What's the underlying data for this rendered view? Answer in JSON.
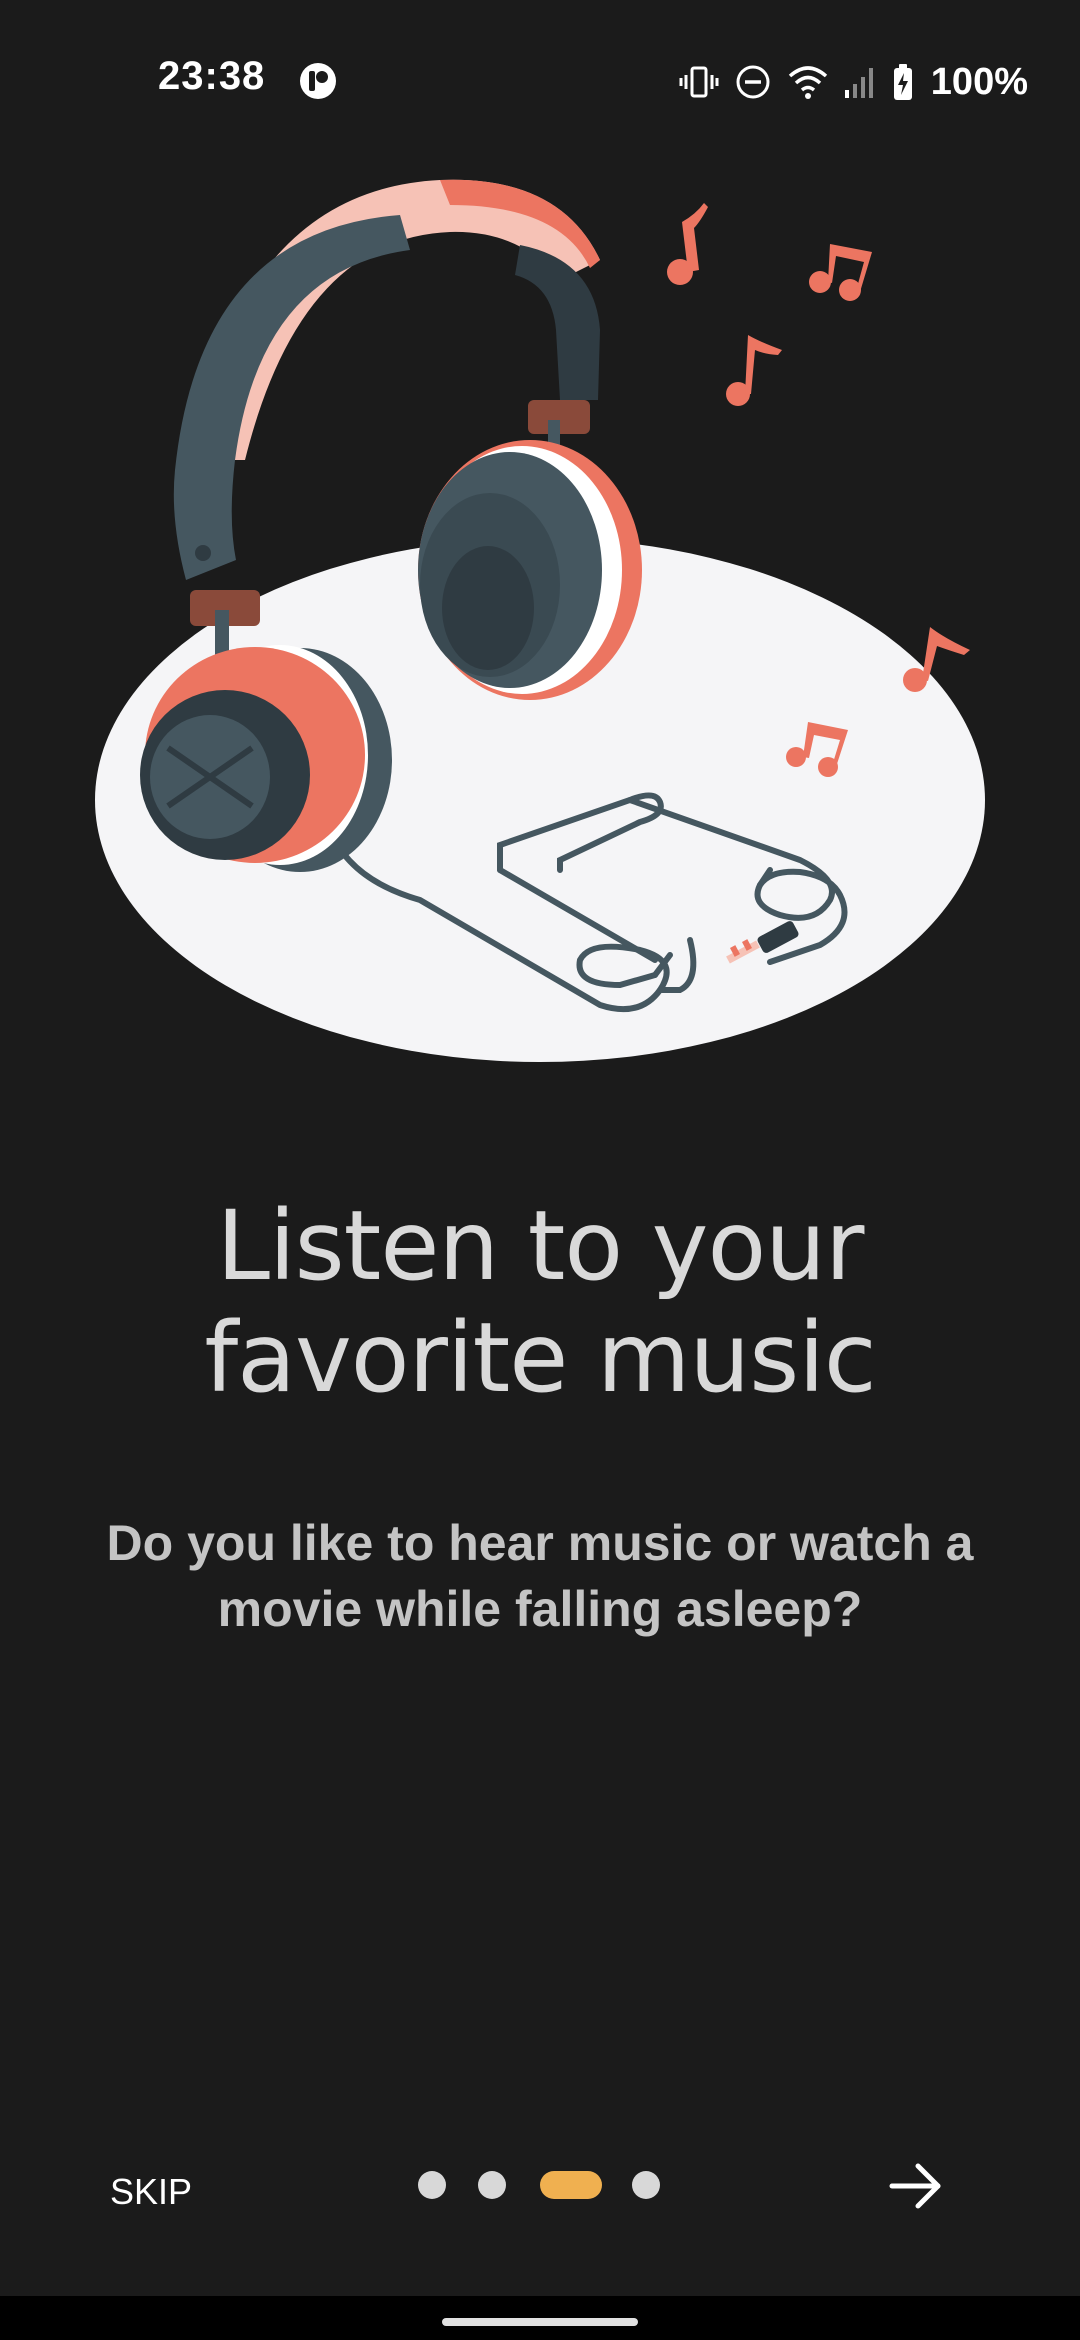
{
  "status_bar": {
    "time": "23:38",
    "battery_percent": "100%",
    "icons": [
      "app-notification-icon",
      "vibrate-icon",
      "do-not-disturb-icon",
      "wifi-icon",
      "cellular-signal-icon",
      "battery-charging-icon"
    ]
  },
  "illustration": {
    "subject": "headphones-illustration",
    "colors": {
      "accent": "#ec7561",
      "pink": "#f6c2b6",
      "dark": "#455760",
      "darker": "#2f3b42",
      "platform": "#f5f5f5",
      "background": "#1b1b1b"
    }
  },
  "onboarding": {
    "title": "Listen to your favorite music",
    "description": "Do you like to hear music or watch a movie while falling asleep?",
    "pages_total": 4,
    "current_page": 3
  },
  "navigation": {
    "skip_label": "SKIP",
    "next_icon": "arrow-right-icon"
  },
  "colors": {
    "background": "#1b1b1b",
    "indicator_active": "#f0b050",
    "indicator_inactive": "#d8d8d8",
    "title_text": "#d9d9d9",
    "subtitle_text": "#c4c4c4"
  }
}
